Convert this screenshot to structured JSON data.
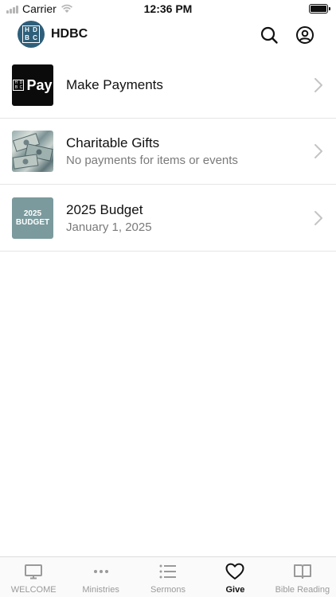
{
  "status_bar": {
    "carrier": "Carrier",
    "time": "12:36 PM",
    "icons": [
      "signal-icon",
      "wifi-icon",
      "battery-icon"
    ]
  },
  "header": {
    "app_title": "HDBC",
    "logo_letters": [
      "H",
      "D",
      "B",
      "C"
    ],
    "icons": [
      "search-icon",
      "account-icon"
    ]
  },
  "list": {
    "items": [
      {
        "title": "Make Payments",
        "subtitle": "",
        "thumb_text": "Pay"
      },
      {
        "title": "Charitable Gifts",
        "subtitle": "No payments for items or events",
        "thumb_text": ""
      },
      {
        "title": "2025 Budget",
        "subtitle": "January 1, 2025",
        "thumb_line1": "2025",
        "thumb_line2": "BUDGET"
      }
    ]
  },
  "tabbar": {
    "active_index": 3,
    "tabs": [
      {
        "label": "WELCOME",
        "icon": "monitor-icon"
      },
      {
        "label": "Ministries",
        "icon": "more-dots-icon"
      },
      {
        "label": "Sermons",
        "icon": "list-icon"
      },
      {
        "label": "Give",
        "icon": "heart-icon"
      },
      {
        "label": "Bible Reading",
        "icon": "book-icon"
      }
    ]
  },
  "colors": {
    "brand": "#2e5f7a",
    "inactive": "#9a9a9a",
    "subtitle": "#7a7a7a",
    "divider": "#e5e5e5"
  }
}
